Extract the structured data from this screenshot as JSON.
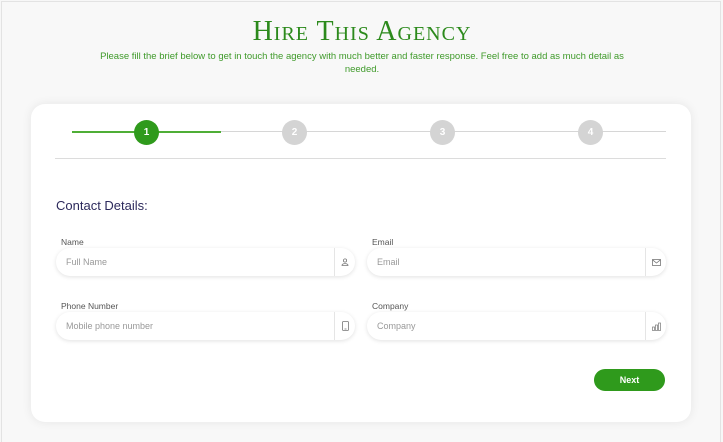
{
  "header": {
    "title": "Hire This Agency",
    "subtitle": "Please fill the brief below to get in touch the agency with much better and faster response. Feel free to add as much detail as needed."
  },
  "steps": [
    {
      "label": "1",
      "active": true
    },
    {
      "label": "2",
      "active": false
    },
    {
      "label": "3",
      "active": false
    },
    {
      "label": "4",
      "active": false
    }
  ],
  "form": {
    "section_title": "Contact Details:",
    "name": {
      "label": "Name",
      "placeholder": "Full Name",
      "value": "",
      "icon": "user-icon"
    },
    "email": {
      "label": "Email",
      "placeholder": "Email",
      "value": "",
      "icon": "envelope-icon"
    },
    "phone": {
      "label": "Phone Number",
      "placeholder": "Mobile phone number",
      "value": "",
      "icon": "phone-icon"
    },
    "company": {
      "label": "Company",
      "placeholder": "Company",
      "value": "",
      "icon": "building-icon"
    },
    "next_label": "Next"
  },
  "colors": {
    "accent": "#2f9a1c",
    "title": "#2c8a1c",
    "section_title": "#2d2a5c"
  }
}
